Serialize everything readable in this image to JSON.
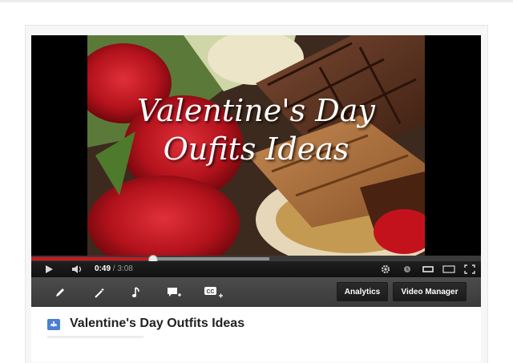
{
  "video": {
    "overlay_line1": "Valentine's Day",
    "overlay_line2": "Oufits Ideas"
  },
  "player": {
    "progress_fraction": 0.269,
    "buffered_fraction": 0.53,
    "time_current": "0:49",
    "time_separator": " / ",
    "time_total": "3:08",
    "icons": [
      "play-icon",
      "volume-icon",
      "settings-gear-icon",
      "annotations-icon",
      "small-player-icon",
      "large-player-icon",
      "fullscreen-icon"
    ]
  },
  "toolbar": {
    "tools": [
      "edit-pencil-icon",
      "enhancements-wand-icon",
      "audio-music-icon",
      "annotations-speech-icon",
      "captions-cc-icon"
    ],
    "cc_label": "CC",
    "analytics_label": "Analytics",
    "video_manager_label": "Video Manager"
  },
  "info": {
    "title": "Valentine's Day Outfits Ideas"
  },
  "colors": {
    "progress": "#cc181e",
    "toolbar": "#404040",
    "title_icon": "#4a7fd4"
  }
}
